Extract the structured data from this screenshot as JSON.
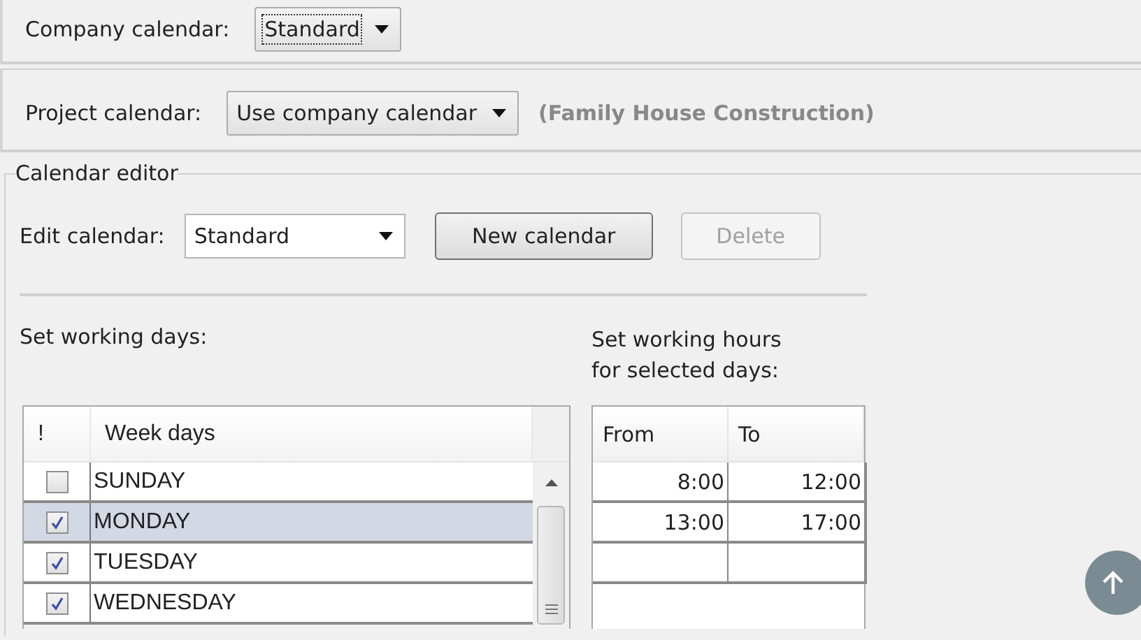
{
  "company_calendar": {
    "label": "Company calendar:",
    "value": "Standard",
    "focused": true
  },
  "project_calendar": {
    "label": "Project calendar:",
    "value": "Use company calendar",
    "project": "(Family House Construction)"
  },
  "calendar_editor": {
    "title": "Calendar editor",
    "edit_label": "Edit calendar:",
    "edit_value": "Standard",
    "buttons": [
      {
        "label": "New calendar",
        "disabled": false
      },
      {
        "label": "Delete",
        "disabled": true
      }
    ],
    "working_days": {
      "label": "Set working days:",
      "columns": [
        "!",
        "Week days"
      ],
      "rows": [
        {
          "day": "SUNDAY",
          "checked": false,
          "selected": false
        },
        {
          "day": "MONDAY",
          "checked": true,
          "selected": true
        },
        {
          "day": "TUESDAY",
          "checked": true,
          "selected": false
        },
        {
          "day": "WEDNESDAY",
          "checked": true,
          "selected": false
        }
      ]
    },
    "working_hours": {
      "label": "Set working hours\nfor selected days:",
      "columns": [
        "From",
        "To"
      ],
      "rows": [
        {
          "from": "8:00",
          "to": "12:00"
        },
        {
          "from": "13:00",
          "to": "17:00"
        }
      ]
    }
  }
}
